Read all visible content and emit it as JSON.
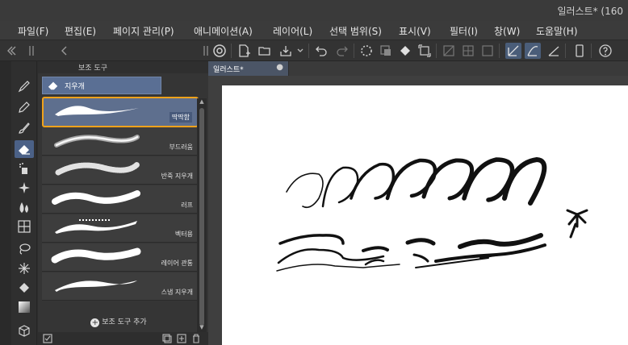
{
  "window": {
    "title": "일러스트* (160"
  },
  "menu": {
    "items": [
      "파일(F)",
      "편집(E)",
      "페이지 관리(P)",
      "애니메이션(A)",
      "레이어(L)",
      "선택 범위(S)",
      "표시(V)",
      "필터(I)",
      "창(W)",
      "도움말(H)"
    ]
  },
  "subtool_panel": {
    "header_label": "보조 도구",
    "group_label": "지우개",
    "brushes": [
      {
        "name": "딱딱함",
        "selected": true
      },
      {
        "name": "부드러움",
        "selected": false
      },
      {
        "name": "반죽 지우개",
        "selected": false
      },
      {
        "name": "러프",
        "selected": false
      },
      {
        "name": "벡터용",
        "selected": false
      },
      {
        "name": "레이어 관통",
        "selected": false
      },
      {
        "name": "스냅 지우개",
        "selected": false
      }
    ],
    "add_label": "보조 도구 추가"
  },
  "document": {
    "tab_label": "일러스트*",
    "close_glyph": "●"
  },
  "colors": {
    "accent_selected_border": "#f0a21b",
    "selected_bg": "#5e6f8e",
    "panel_bg": "#353535",
    "canvas_bg": "#ffffff"
  },
  "tools": [
    "pen-icon",
    "pencil-icon",
    "brush-icon",
    "eraser-icon",
    "airbrush-icon",
    "decoration-icon",
    "blend-icon",
    "frame-icon",
    "lasso-icon",
    "auto-select-icon",
    "fill-icon",
    "gradient-icon",
    "3d-object-icon"
  ]
}
